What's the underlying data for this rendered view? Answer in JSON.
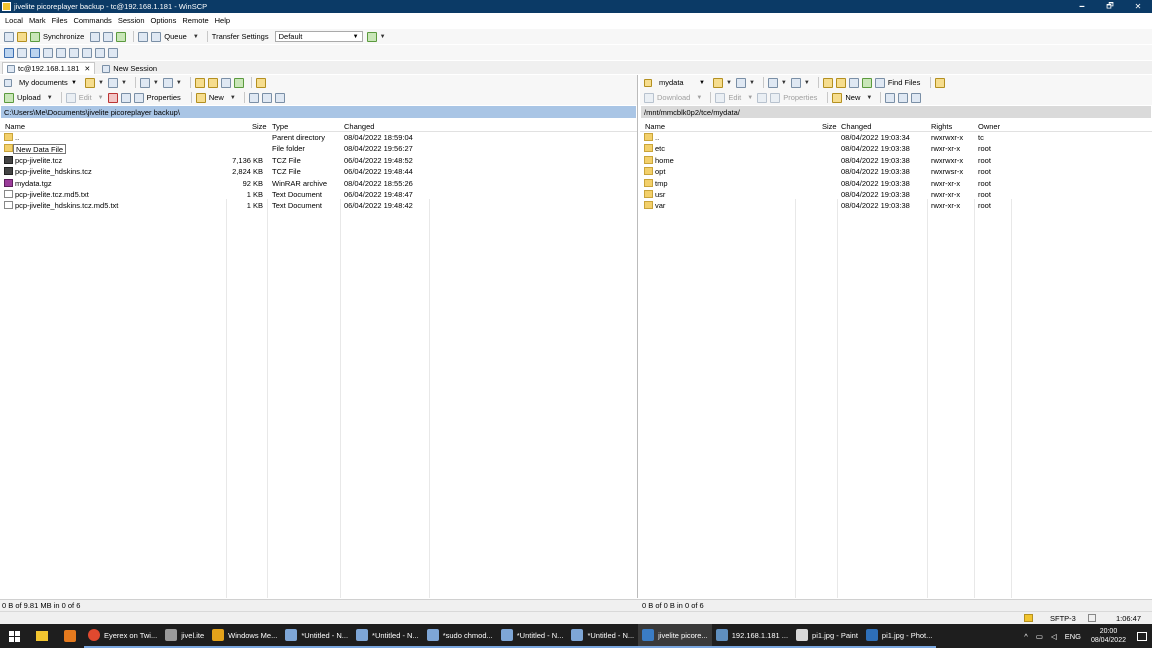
{
  "window": {
    "title": "jivelite picoreplayer backup - tc@192.168.1.181 - WinSCP",
    "minimize": "🗕",
    "maximize": "🗗",
    "close": "✕"
  },
  "menu": [
    "Local",
    "Mark",
    "Files",
    "Commands",
    "Session",
    "Options",
    "Remote",
    "Help"
  ],
  "toolbar": {
    "synchronize": "Synchronize",
    "queue": "Queue",
    "transfer_settings": "Transfer Settings",
    "transfer_preset": "Default"
  },
  "tabs": [
    {
      "label": "tc@192.168.1.181",
      "close": "✕"
    },
    {
      "label": "New Session"
    }
  ],
  "left": {
    "location": "My documents",
    "upload": "Upload",
    "edit": "Edit",
    "properties": "Properties",
    "new": "New",
    "path": "C:\\Users\\Me\\Documents\\jivelite picoreplayer backup\\",
    "columns": {
      "name": "Name",
      "size": "Size",
      "type": "Type",
      "changed": "Changed"
    },
    "tooltip": "New Data File",
    "files": [
      {
        "icon": "up",
        "name": "..",
        "size": "",
        "type": "Parent directory",
        "changed": "08/04/2022 18:59:04"
      },
      {
        "icon": "folder",
        "name": "",
        "size": "",
        "type": "File folder",
        "changed": "08/04/2022 19:56:27"
      },
      {
        "icon": "tcz",
        "name": "pcp-jivelite.tcz",
        "size": "7,136 KB",
        "type": "TCZ File",
        "changed": "06/04/2022 19:48:52"
      },
      {
        "icon": "tcz",
        "name": "pcp-jivelite_hdskins.tcz",
        "size": "2,824 KB",
        "type": "TCZ File",
        "changed": "06/04/2022 19:48:44"
      },
      {
        "icon": "rar",
        "name": "mydata.tgz",
        "size": "92 KB",
        "type": "WinRAR archive",
        "changed": "08/04/2022 18:55:26"
      },
      {
        "icon": "txt",
        "name": "pcp-jivelite.tcz.md5.txt",
        "size": "1 KB",
        "type": "Text Document",
        "changed": "06/04/2022 19:48:47"
      },
      {
        "icon": "txt",
        "name": "pcp-jivelite_hdskins.tcz.md5.txt",
        "size": "1 KB",
        "type": "Text Document",
        "changed": "06/04/2022 19:48:42"
      }
    ],
    "status": "0 B of 9.81 MB in 0 of 6"
  },
  "right": {
    "location": "mydata",
    "find_files": "Find Files",
    "download": "Download",
    "edit": "Edit",
    "properties": "Properties",
    "new": "New",
    "path": "/mnt/mmcblk0p2/tce/mydata/",
    "columns": {
      "name": "Name",
      "size": "Size",
      "changed": "Changed",
      "rights": "Rights",
      "owner": "Owner"
    },
    "files": [
      {
        "icon": "up",
        "name": "..",
        "changed": "08/04/2022 19:03:34",
        "rights": "rwxrwxr-x",
        "owner": "tc"
      },
      {
        "icon": "folder",
        "name": "etc",
        "changed": "08/04/2022 19:03:38",
        "rights": "rwxr-xr-x",
        "owner": "root"
      },
      {
        "icon": "folder",
        "name": "home",
        "changed": "08/04/2022 19:03:38",
        "rights": "rwxrwxr-x",
        "owner": "root"
      },
      {
        "icon": "folder",
        "name": "opt",
        "changed": "08/04/2022 19:03:38",
        "rights": "rwxrwsr-x",
        "owner": "root"
      },
      {
        "icon": "folder",
        "name": "tmp",
        "changed": "08/04/2022 19:03:38",
        "rights": "rwxr-xr-x",
        "owner": "root"
      },
      {
        "icon": "folder",
        "name": "usr",
        "changed": "08/04/2022 19:03:38",
        "rights": "rwxr-xr-x",
        "owner": "root"
      },
      {
        "icon": "folder",
        "name": "var",
        "changed": "08/04/2022 19:03:38",
        "rights": "rwxr-xr-x",
        "owner": "root"
      }
    ],
    "status": "0 B of 0 B in 0 of 6"
  },
  "connection": {
    "protocol": "SFTP-3",
    "elapsed": "1:06:47"
  },
  "taskbar": {
    "items": [
      {
        "label": "Eyerex on Twi...",
        "color": "#e0492f"
      },
      {
        "label": "jivel.ite",
        "color": "#9a9a9a"
      },
      {
        "label": "Windows Me...",
        "color": "#e3a21a"
      },
      {
        "label": "*Untitled - N...",
        "color": "#7ea6d6"
      },
      {
        "label": "*Untitled - N...",
        "color": "#7ea6d6"
      },
      {
        "label": "*sudo chmod...",
        "color": "#7ea6d6"
      },
      {
        "label": "*Untitled - N...",
        "color": "#7ea6d6"
      },
      {
        "label": "*Untitled - N...",
        "color": "#7ea6d6"
      },
      {
        "label": "jivelite picore...",
        "color": "#3a7cc4"
      },
      {
        "label": "192.168.1.181 ...",
        "color": "#5f8fbf"
      },
      {
        "label": "pi1.jpg - Paint",
        "color": "#d8d8d8"
      },
      {
        "label": "pi1.jpg - Phot...",
        "color": "#2e6fb8"
      }
    ],
    "language": "ENG",
    "time": "20:00",
    "date": "08/04/2022"
  },
  "colors": {
    "titlebar": "#0b3a66",
    "path_active": "#a9c5e5",
    "taskbar": "#1e1e1e"
  }
}
